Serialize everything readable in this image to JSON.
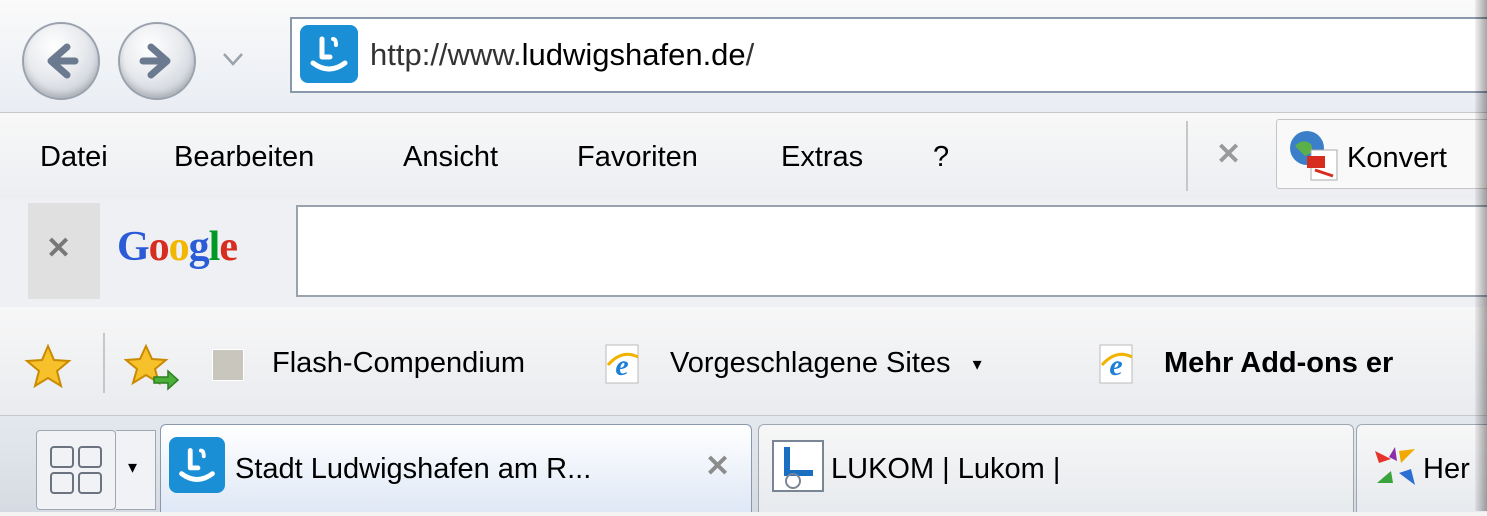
{
  "address_bar": {
    "url_prefix": "http://www.",
    "url_domain": "ludwigshafen.de",
    "url_suffix": "/"
  },
  "menu": {
    "items": [
      "Datei",
      "Bearbeiten",
      "Ansicht",
      "Favoriten",
      "Extras",
      "?"
    ],
    "convert_label": "Konvert"
  },
  "google_toolbar": {
    "logo_letters": [
      "G",
      "o",
      "o",
      "g",
      "l",
      "e"
    ],
    "logo_colors": [
      "#2b5bd7",
      "#d62d20",
      "#f2b700",
      "#2b5bd7",
      "#009925",
      "#d62d20"
    ],
    "search_value": ""
  },
  "favorites_bar": {
    "items": [
      {
        "label": "Flash-Compendium",
        "icon": "blank-page-icon"
      },
      {
        "label": "Vorgeschlagene Sites",
        "icon": "ie-icon",
        "has_dropdown": true
      },
      {
        "label": "Mehr Add-ons er",
        "icon": "ie-icon",
        "bold": true
      }
    ]
  },
  "tabs": [
    {
      "title": "Stadt Ludwigshafen am R...",
      "active": true,
      "icon": "ludwigshafen-icon"
    },
    {
      "title": "LUKOM | Lukom |",
      "active": false,
      "icon": "lukom-icon"
    },
    {
      "title": "Her",
      "active": false,
      "icon": "colorful-arrows-icon"
    }
  ],
  "colors": {
    "accent": "#1a8fd6",
    "frame": "#f4f4f4"
  }
}
